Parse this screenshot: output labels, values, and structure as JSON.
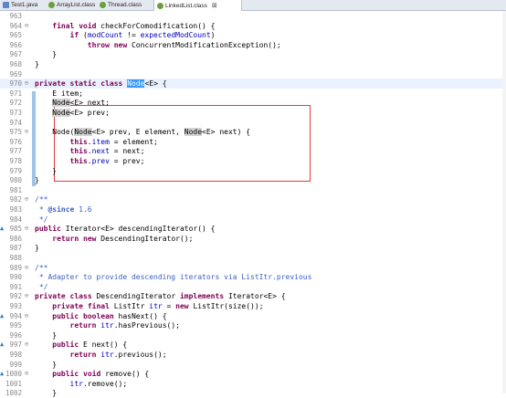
{
  "tabs": [
    {
      "label": "Test1.java",
      "icon": "java-file-icon",
      "active": false
    },
    {
      "label": "ArrayList.class",
      "icon": "class-file-icon",
      "active": false
    },
    {
      "label": "Thread.class",
      "icon": "class-file-icon",
      "active": false
    },
    {
      "label": "LinkedList.class",
      "icon": "class-file-icon",
      "active": true
    }
  ],
  "close_glyph": "⊠",
  "lines": [
    {
      "n": "963",
      "code": ""
    },
    {
      "n": "964",
      "code": "    final void checkForComodification() {"
    },
    {
      "n": "965",
      "code": "        if (modCount != expectedModCount)"
    },
    {
      "n": "966",
      "code": "            throw new ConcurrentModificationException();"
    },
    {
      "n": "967",
      "code": "    }"
    },
    {
      "n": "968",
      "code": "}"
    },
    {
      "n": "969",
      "code": ""
    },
    {
      "n": "970",
      "code": "private static class Node<E> {"
    },
    {
      "n": "971",
      "code": "    E item;"
    },
    {
      "n": "972",
      "code": "    Node<E> next;"
    },
    {
      "n": "973",
      "code": "    Node<E> prev;"
    },
    {
      "n": "974",
      "code": ""
    },
    {
      "n": "975",
      "code": "    Node(Node<E> prev, E element, Node<E> next) {"
    },
    {
      "n": "976",
      "code": "        this.item = element;"
    },
    {
      "n": "977",
      "code": "        this.next = next;"
    },
    {
      "n": "978",
      "code": "        this.prev = prev;"
    },
    {
      "n": "979",
      "code": "    }"
    },
    {
      "n": "980",
      "code": "}"
    },
    {
      "n": "981",
      "code": ""
    },
    {
      "n": "982",
      "code": "/**"
    },
    {
      "n": "983",
      "code": " * @since 1.6"
    },
    {
      "n": "984",
      "code": " */"
    },
    {
      "n": "985",
      "code": "public Iterator<E> descendingIterator() {"
    },
    {
      "n": "986",
      "code": "    return new DescendingIterator();"
    },
    {
      "n": "987",
      "code": "}"
    },
    {
      "n": "988",
      "code": ""
    },
    {
      "n": "989",
      "code": "/**"
    },
    {
      "n": "990",
      "code": " * Adapter to provide descending iterators via ListItr.previous"
    },
    {
      "n": "991",
      "code": " */"
    },
    {
      "n": "992",
      "code": "private class DescendingIterator implements Iterator<E> {"
    },
    {
      "n": "993",
      "code": "    private final ListItr itr = new ListItr(size());"
    },
    {
      "n": "994",
      "code": "    public boolean hasNext() {"
    },
    {
      "n": "995",
      "code": "        return itr.hasPrevious();"
    },
    {
      "n": "996",
      "code": "    }"
    },
    {
      "n": "997",
      "code": "    public E next() {"
    },
    {
      "n": "998",
      "code": "        return itr.previous();"
    },
    {
      "n": "999",
      "code": "    }"
    },
    {
      "n": "1000",
      "code": "    public void remove() {"
    },
    {
      "n": "1001",
      "code": "        itr.remove();"
    },
    {
      "n": "1002",
      "code": "    }"
    }
  ],
  "current_line": "970",
  "fold_lines": [
    "964",
    "970",
    "975",
    "982",
    "985",
    "989",
    "992",
    "994",
    "997",
    "1000"
  ],
  "override_lines": [
    "985",
    "994",
    "997",
    "1000"
  ],
  "colors": {
    "keyword": "#7f0055",
    "field": "#0000c0",
    "comment": "#3f5fbf",
    "selection": "#3399ff",
    "highlight_box": "#e23a3a"
  }
}
